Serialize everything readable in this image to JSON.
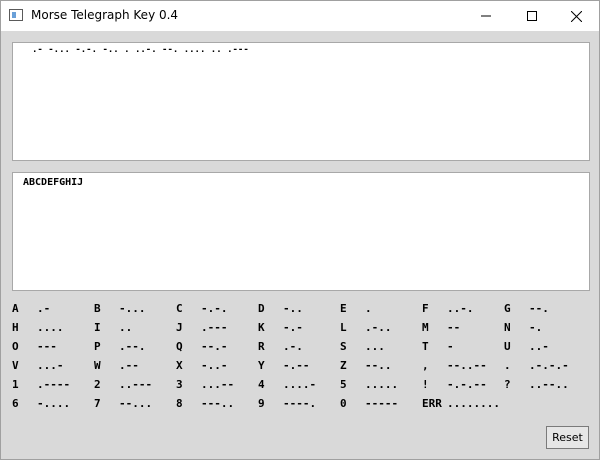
{
  "window": {
    "title": "Morse Telegraph Key 0.4"
  },
  "morse_output": {
    "text": ".- -... -.-. -.. . ..-. --. .... .. .---"
  },
  "text_output": {
    "text": "ABCDEFGHIJ"
  },
  "legend": [
    {
      "char": "A",
      "code": ".-"
    },
    {
      "char": "B",
      "code": "-..."
    },
    {
      "char": "C",
      "code": "-.-."
    },
    {
      "char": "D",
      "code": "-.."
    },
    {
      "char": "E",
      "code": "."
    },
    {
      "char": "F",
      "code": "..-."
    },
    {
      "char": "G",
      "code": "--."
    },
    {
      "char": "H",
      "code": "...."
    },
    {
      "char": "I",
      "code": ".."
    },
    {
      "char": "J",
      "code": ".---"
    },
    {
      "char": "K",
      "code": "-.-"
    },
    {
      "char": "L",
      "code": ".-.."
    },
    {
      "char": "M",
      "code": "--"
    },
    {
      "char": "N",
      "code": "-."
    },
    {
      "char": "O",
      "code": "---"
    },
    {
      "char": "P",
      "code": ".--."
    },
    {
      "char": "Q",
      "code": "--.-"
    },
    {
      "char": "R",
      "code": ".-."
    },
    {
      "char": "S",
      "code": "..."
    },
    {
      "char": "T",
      "code": "-"
    },
    {
      "char": "U",
      "code": "..-"
    },
    {
      "char": "V",
      "code": "...-"
    },
    {
      "char": "W",
      "code": ".--"
    },
    {
      "char": "X",
      "code": "-..-"
    },
    {
      "char": "Y",
      "code": "-.--"
    },
    {
      "char": "Z",
      "code": "--.."
    },
    {
      "char": ",",
      "code": "--..--"
    },
    {
      "char": ".",
      "code": ".-.-.-"
    },
    {
      "char": "1",
      "code": ".----"
    },
    {
      "char": "2",
      "code": "..---"
    },
    {
      "char": "3",
      "code": "...--"
    },
    {
      "char": "4",
      "code": "....-"
    },
    {
      "char": "5",
      "code": "....."
    },
    {
      "char": "!",
      "code": "-.-.--"
    },
    {
      "char": "?",
      "code": "..--.."
    },
    {
      "char": "6",
      "code": "-...."
    },
    {
      "char": "7",
      "code": "--..."
    },
    {
      "char": "8",
      "code": "---.."
    },
    {
      "char": "9",
      "code": "----."
    },
    {
      "char": "0",
      "code": "-----"
    },
    {
      "char": "ERR",
      "code": "........"
    }
  ],
  "buttons": {
    "reset_label": "Reset"
  },
  "icons": {
    "app": "telegraph-app-icon",
    "minimize": "minimize-icon",
    "maximize": "maximize-icon",
    "close": "close-icon"
  }
}
